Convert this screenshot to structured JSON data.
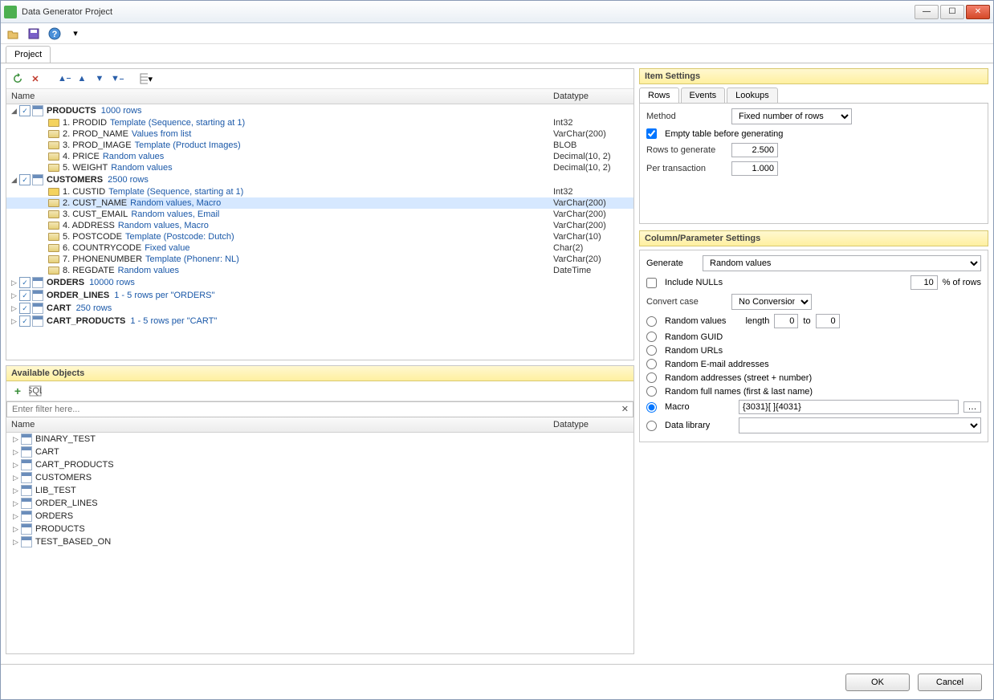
{
  "window": {
    "title": "Data Generator Project"
  },
  "tabs": {
    "project": "Project"
  },
  "columns": {
    "name": "Name",
    "datatype": "Datatype"
  },
  "tree": [
    {
      "type": "table",
      "name": "PRODUCTS",
      "info": "1000 rows",
      "expanded": true,
      "checked": true,
      "children": [
        {
          "idx": "1.",
          "name": "PRODID",
          "info": "Template (Sequence, starting at 1)",
          "dt": "Int32",
          "key": true
        },
        {
          "idx": "2.",
          "name": "PROD_NAME",
          "info": "Values from list",
          "dt": "VarChar(200)"
        },
        {
          "idx": "3.",
          "name": "PROD_IMAGE",
          "info": "Template (Product Images)",
          "dt": "BLOB"
        },
        {
          "idx": "4.",
          "name": "PRICE",
          "info": "Random values",
          "dt": "Decimal(10, 2)"
        },
        {
          "idx": "5.",
          "name": "WEIGHT",
          "info": "Random values",
          "dt": "Decimal(10, 2)"
        }
      ]
    },
    {
      "type": "table",
      "name": "CUSTOMERS",
      "info": "2500 rows",
      "expanded": true,
      "checked": true,
      "children": [
        {
          "idx": "1.",
          "name": "CUSTID",
          "info": "Template (Sequence, starting at 1)",
          "dt": "Int32",
          "key": true
        },
        {
          "idx": "2.",
          "name": "CUST_NAME",
          "info": "Random values, Macro",
          "dt": "VarChar(200)",
          "sel": true
        },
        {
          "idx": "3.",
          "name": "CUST_EMAIL",
          "info": "Random values, Email",
          "dt": "VarChar(200)"
        },
        {
          "idx": "4.",
          "name": "ADDRESS",
          "info": "Random values, Macro",
          "dt": "VarChar(200)"
        },
        {
          "idx": "5.",
          "name": "POSTCODE",
          "info": "Template (Postcode: Dutch)",
          "dt": "VarChar(10)"
        },
        {
          "idx": "6.",
          "name": "COUNTRYCODE",
          "info": "Fixed value",
          "dt": "Char(2)"
        },
        {
          "idx": "7.",
          "name": "PHONENUMBER",
          "info": "Template (Phonenr: NL)",
          "dt": "VarChar(20)"
        },
        {
          "idx": "8.",
          "name": "REGDATE",
          "info": "Random values",
          "dt": "DateTime"
        }
      ]
    },
    {
      "type": "table",
      "name": "ORDERS",
      "info": "10000 rows",
      "expanded": false,
      "checked": true
    },
    {
      "type": "table",
      "name": "ORDER_LINES",
      "info": "1 - 5 rows per \"ORDERS\"",
      "expanded": false,
      "checked": true
    },
    {
      "type": "table",
      "name": "CART",
      "info": "250 rows",
      "expanded": false,
      "checked": true
    },
    {
      "type": "table",
      "name": "CART_PRODUCTS",
      "info": "1 - 5 rows per \"CART\"",
      "expanded": false,
      "checked": true
    }
  ],
  "available": {
    "title": "Available Objects",
    "filter_placeholder": "Enter filter here...",
    "cols": {
      "name": "Name",
      "datatype": "Datatype"
    },
    "items": [
      "BINARY_TEST",
      "CART",
      "CART_PRODUCTS",
      "CUSTOMERS",
      "LIB_TEST",
      "ORDER_LINES",
      "ORDERS",
      "PRODUCTS",
      "TEST_BASED_ON"
    ]
  },
  "item_settings": {
    "title": "Item Settings",
    "tabs": [
      "Rows",
      "Events",
      "Lookups"
    ],
    "method_label": "Method",
    "method_value": "Fixed number of rows",
    "empty_label": "Empty table before generating",
    "empty_checked": true,
    "rows_label": "Rows to generate",
    "rows_value": "2.500",
    "pertx_label": "Per transaction",
    "pertx_value": "1.000"
  },
  "col_settings": {
    "title": "Column/Parameter Settings",
    "generate_label": "Generate",
    "generate_value": "Random values",
    "nulls_label": "Include NULLs",
    "nulls_pct": "10",
    "nulls_suffix": "% of rows",
    "convert_label": "Convert case",
    "convert_value": "No Conversion",
    "radios": {
      "random": "Random values",
      "length": "length",
      "to": "to",
      "len_from": "0",
      "len_to": "0",
      "guid": "Random GUID",
      "urls": "Random URLs",
      "email": "Random E-mail addresses",
      "addr": "Random addresses (street + number)",
      "fullname": "Random full names (first & last name)",
      "macro": "Macro",
      "macro_value": "{3031}[ ]{4031}",
      "datalib": "Data library"
    }
  },
  "buttons": {
    "ok": "OK",
    "cancel": "Cancel"
  }
}
